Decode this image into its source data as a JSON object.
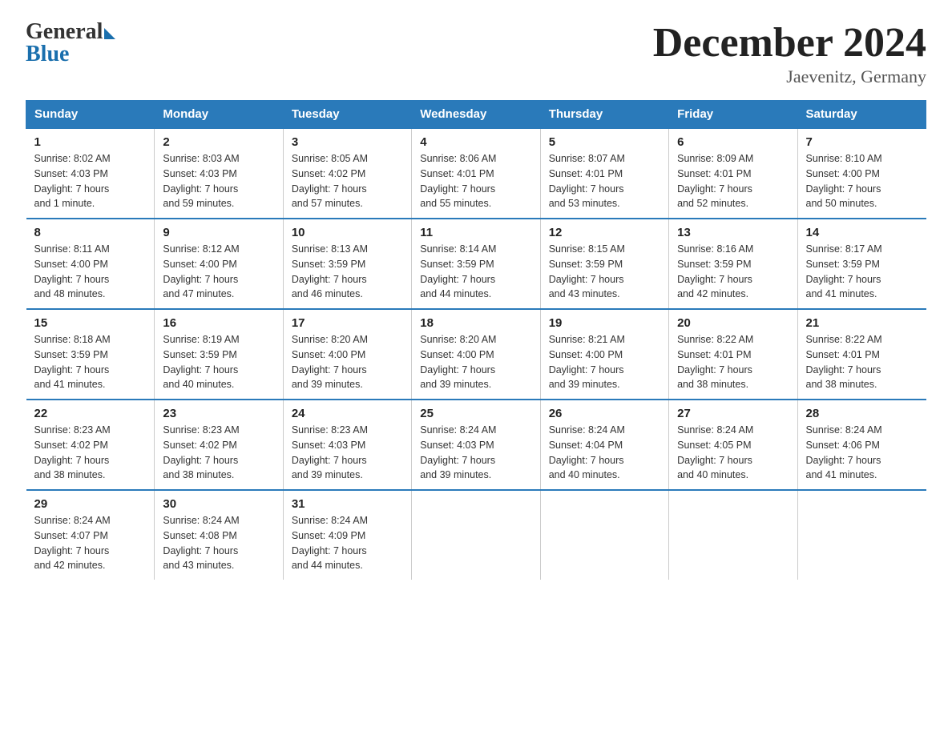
{
  "logo": {
    "general": "General",
    "blue": "Blue"
  },
  "title": "December 2024",
  "location": "Jaevenitz, Germany",
  "days_of_week": [
    "Sunday",
    "Monday",
    "Tuesday",
    "Wednesday",
    "Thursday",
    "Friday",
    "Saturday"
  ],
  "weeks": [
    [
      {
        "day": "1",
        "sunrise": "8:02 AM",
        "sunset": "4:03 PM",
        "daylight": "7 hours and 1 minute."
      },
      {
        "day": "2",
        "sunrise": "8:03 AM",
        "sunset": "4:03 PM",
        "daylight": "7 hours and 59 minutes."
      },
      {
        "day": "3",
        "sunrise": "8:05 AM",
        "sunset": "4:02 PM",
        "daylight": "7 hours and 57 minutes."
      },
      {
        "day": "4",
        "sunrise": "8:06 AM",
        "sunset": "4:01 PM",
        "daylight": "7 hours and 55 minutes."
      },
      {
        "day": "5",
        "sunrise": "8:07 AM",
        "sunset": "4:01 PM",
        "daylight": "7 hours and 53 minutes."
      },
      {
        "day": "6",
        "sunrise": "8:09 AM",
        "sunset": "4:01 PM",
        "daylight": "7 hours and 52 minutes."
      },
      {
        "day": "7",
        "sunrise": "8:10 AM",
        "sunset": "4:00 PM",
        "daylight": "7 hours and 50 minutes."
      }
    ],
    [
      {
        "day": "8",
        "sunrise": "8:11 AM",
        "sunset": "4:00 PM",
        "daylight": "7 hours and 48 minutes."
      },
      {
        "day": "9",
        "sunrise": "8:12 AM",
        "sunset": "4:00 PM",
        "daylight": "7 hours and 47 minutes."
      },
      {
        "day": "10",
        "sunrise": "8:13 AM",
        "sunset": "3:59 PM",
        "daylight": "7 hours and 46 minutes."
      },
      {
        "day": "11",
        "sunrise": "8:14 AM",
        "sunset": "3:59 PM",
        "daylight": "7 hours and 44 minutes."
      },
      {
        "day": "12",
        "sunrise": "8:15 AM",
        "sunset": "3:59 PM",
        "daylight": "7 hours and 43 minutes."
      },
      {
        "day": "13",
        "sunrise": "8:16 AM",
        "sunset": "3:59 PM",
        "daylight": "7 hours and 42 minutes."
      },
      {
        "day": "14",
        "sunrise": "8:17 AM",
        "sunset": "3:59 PM",
        "daylight": "7 hours and 41 minutes."
      }
    ],
    [
      {
        "day": "15",
        "sunrise": "8:18 AM",
        "sunset": "3:59 PM",
        "daylight": "7 hours and 41 minutes."
      },
      {
        "day": "16",
        "sunrise": "8:19 AM",
        "sunset": "3:59 PM",
        "daylight": "7 hours and 40 minutes."
      },
      {
        "day": "17",
        "sunrise": "8:20 AM",
        "sunset": "4:00 PM",
        "daylight": "7 hours and 39 minutes."
      },
      {
        "day": "18",
        "sunrise": "8:20 AM",
        "sunset": "4:00 PM",
        "daylight": "7 hours and 39 minutes."
      },
      {
        "day": "19",
        "sunrise": "8:21 AM",
        "sunset": "4:00 PM",
        "daylight": "7 hours and 39 minutes."
      },
      {
        "day": "20",
        "sunrise": "8:22 AM",
        "sunset": "4:01 PM",
        "daylight": "7 hours and 38 minutes."
      },
      {
        "day": "21",
        "sunrise": "8:22 AM",
        "sunset": "4:01 PM",
        "daylight": "7 hours and 38 minutes."
      }
    ],
    [
      {
        "day": "22",
        "sunrise": "8:23 AM",
        "sunset": "4:02 PM",
        "daylight": "7 hours and 38 minutes."
      },
      {
        "day": "23",
        "sunrise": "8:23 AM",
        "sunset": "4:02 PM",
        "daylight": "7 hours and 38 minutes."
      },
      {
        "day": "24",
        "sunrise": "8:23 AM",
        "sunset": "4:03 PM",
        "daylight": "7 hours and 39 minutes."
      },
      {
        "day": "25",
        "sunrise": "8:24 AM",
        "sunset": "4:03 PM",
        "daylight": "7 hours and 39 minutes."
      },
      {
        "day": "26",
        "sunrise": "8:24 AM",
        "sunset": "4:04 PM",
        "daylight": "7 hours and 40 minutes."
      },
      {
        "day": "27",
        "sunrise": "8:24 AM",
        "sunset": "4:05 PM",
        "daylight": "7 hours and 40 minutes."
      },
      {
        "day": "28",
        "sunrise": "8:24 AM",
        "sunset": "4:06 PM",
        "daylight": "7 hours and 41 minutes."
      }
    ],
    [
      {
        "day": "29",
        "sunrise": "8:24 AM",
        "sunset": "4:07 PM",
        "daylight": "7 hours and 42 minutes."
      },
      {
        "day": "30",
        "sunrise": "8:24 AM",
        "sunset": "4:08 PM",
        "daylight": "7 hours and 43 minutes."
      },
      {
        "day": "31",
        "sunrise": "8:24 AM",
        "sunset": "4:09 PM",
        "daylight": "7 hours and 44 minutes."
      },
      null,
      null,
      null,
      null
    ]
  ],
  "labels": {
    "sunrise": "Sunrise:",
    "sunset": "Sunset:",
    "daylight": "Daylight:"
  }
}
